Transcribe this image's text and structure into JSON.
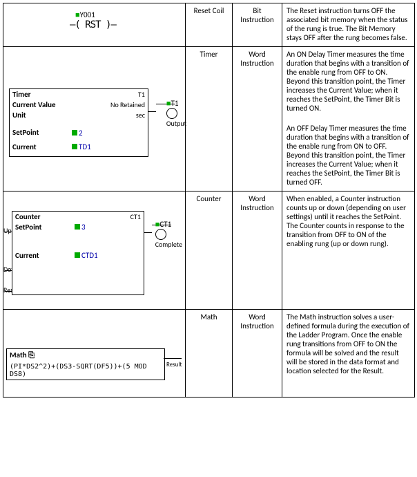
{
  "table": {
    "rows": [
      {
        "diag": {
          "type": "reset",
          "device": "Y001",
          "symbol": "RST"
        },
        "name": "Reset Coil",
        "kind": "Bit Instruction",
        "desc1": "The Reset instruction turns OFF the associated bit memory when the status of the rung is true. The Bit Memory stays OFF after the rung becomes false."
      },
      {
        "diag": {
          "type": "timer",
          "title": "Timer",
          "id": "T1",
          "cv": "Current Value",
          "ret": "No Retained",
          "unit": "Unit",
          "unitv": "sec",
          "sp": "SetPoint",
          "spv": "2",
          "cur": "Current",
          "curv": "TD1",
          "out": "T1",
          "outlbl": "Output"
        },
        "name": "Timer",
        "kind": "Word Instruction",
        "desc1": "An ON Delay Timer measures the time duration that begins with a transition of the enable rung from OFF to ON. Beyond this transition point, the Timer increases the Current Value; when it reaches the SetPoint, the Timer Bit is turned ON.",
        "desc2": "An OFF Delay Timer measures the time duration that begins with a transition of the enable rung from ON to OFF. Beyond this transition point, the Timer increases the Current Value; when it reaches the SetPoint, the Timer Bit is turned OFF."
      },
      {
        "diag": {
          "type": "counter",
          "title": "Counter",
          "id": "CT1",
          "sp": "SetPoint",
          "spv": "3",
          "cur": "Current",
          "curv": "CTD1",
          "out": "CT1",
          "outlbl": "Complete",
          "in_up": "Up",
          "in_down": "Down",
          "in_reset": "Reset"
        },
        "name": "Counter",
        "kind": "Word Instruction",
        "desc1": "When enabled, a Counter instruction counts up or down (depending on user settings) until it reaches the SetPoint. The Counter counts in response to the transition from OFF to ON of the enabling rung (up or down rung)."
      },
      {
        "diag": {
          "type": "math",
          "title": "Math",
          "icon": "⎘",
          "expr": "(PI*DS2^2)+(DS3-SQRT(DF5))+(5 MOD DS8)",
          "out": "Result"
        },
        "name": "Math",
        "kind": "Word Instruction",
        "desc1": "The Math instruction solves a user-defined formula during the execution of the Ladder Program. Once the enable rung transitions from OFF to ON the formula will be solved and the result will be stored in the data format and location selected for the Result."
      }
    ]
  }
}
